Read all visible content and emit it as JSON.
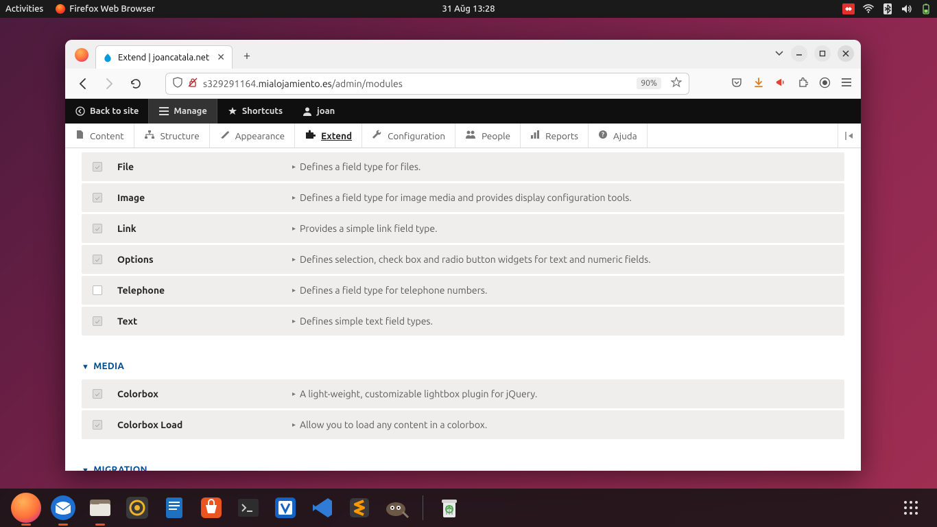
{
  "gnome": {
    "activities": "Activities",
    "app_name": "Firefox Web Browser",
    "datetime": "31 Aŭg  13:28"
  },
  "browser": {
    "tab_title": "Extend | joancatala.net",
    "url_prefix": "s329291164.",
    "url_host": "mi­alojamiento.es",
    "url_path": "/admin/modules",
    "zoom": "90%"
  },
  "drupal_top": {
    "back": "Back to site",
    "manage": "Manage",
    "shortcuts": "Shortcuts",
    "user": "joan"
  },
  "drupal_tabs": {
    "content": "Content",
    "structure": "Structure",
    "appearance": "Appearance",
    "extend": "Extend",
    "configuration": "Configuration",
    "people": "People",
    "reports": "Reports",
    "help": "Ajuda"
  },
  "modules_field": [
    {
      "name": "File",
      "desc": "Defines a field type for files.",
      "checked": true
    },
    {
      "name": "Image",
      "desc": "Defines a field type for image media and provides display configuration tools.",
      "checked": true
    },
    {
      "name": "Link",
      "desc": "Provides a simple link field type.",
      "checked": true
    },
    {
      "name": "Options",
      "desc": "Defines selection, check box and radio button widgets for text and numeric fields.",
      "checked": true
    },
    {
      "name": "Telephone",
      "desc": "Defines a field type for telephone numbers.",
      "checked": false
    },
    {
      "name": "Text",
      "desc": "Defines simple text field types.",
      "checked": true
    }
  ],
  "section_media": "MEDIA",
  "modules_media": [
    {
      "name": "Colorbox",
      "desc": "A light-weight, customizable lightbox plugin for jQuery.",
      "checked": true
    },
    {
      "name": "Colorbox Load",
      "desc": "Allow you to load any content in a colorbox.",
      "checked": true
    }
  ],
  "section_migration": "MIGRATION"
}
